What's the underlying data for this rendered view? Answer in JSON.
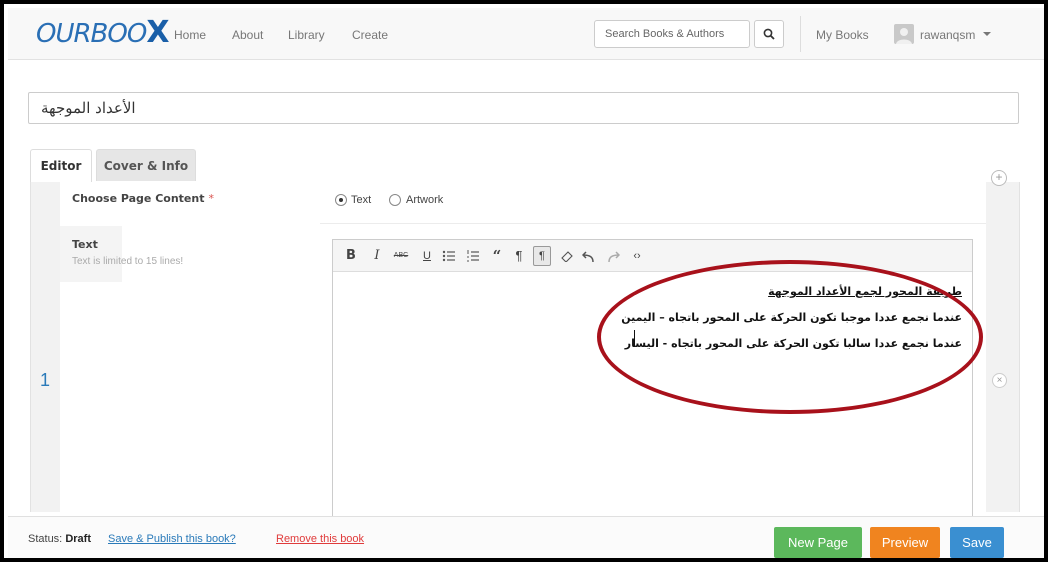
{
  "nav": {
    "logo_text": "OURBOO",
    "logo_x": "X",
    "links": [
      "Home",
      "About",
      "Library",
      "Create"
    ],
    "search_placeholder": "Search Books & Authors",
    "mybooks": "My Books",
    "username": "rawanqsm"
  },
  "book": {
    "title": "الأعداد الموجهة"
  },
  "tabs": {
    "editor": "Editor",
    "cover": "Cover & Info"
  },
  "page": {
    "number": "1",
    "choose_label": "Choose Page Content",
    "required_mark": "*",
    "radio_text": "Text",
    "radio_artwork": "Artwork",
    "selected": "Text",
    "text_label": "Text",
    "text_hint": "Text is limited to 15 lines!"
  },
  "toolbar": {
    "buttons": [
      "bold",
      "italic",
      "strikethrough",
      "underline",
      "bulleted-list",
      "numbered-list",
      "quote",
      "ltr",
      "rtl",
      "eraser",
      "undo",
      "redo",
      "code"
    ]
  },
  "editor": {
    "lines": [
      "طريقة المحور لجمع الأعداد الموجهة",
      "عندما نجمع عددا موجبا تكون الحركة على المحور باتجاه – اليمين",
      "عندما نجمع عددا سالبا تكون الحركة على المحور باتجاه - اليسار"
    ]
  },
  "status": {
    "label": "Status:",
    "value": "Draft",
    "publish_link": "Save & Publish this book?",
    "remove_link": "Remove this book"
  },
  "buttons": {
    "new_page": "New Page",
    "preview": "Preview",
    "save": "Save"
  },
  "colors": {
    "brand": "#2a6fb5",
    "annotation": "#a8111b",
    "new_page": "#5cb85c",
    "preview": "#f0841f",
    "save": "#3a8fd1"
  }
}
